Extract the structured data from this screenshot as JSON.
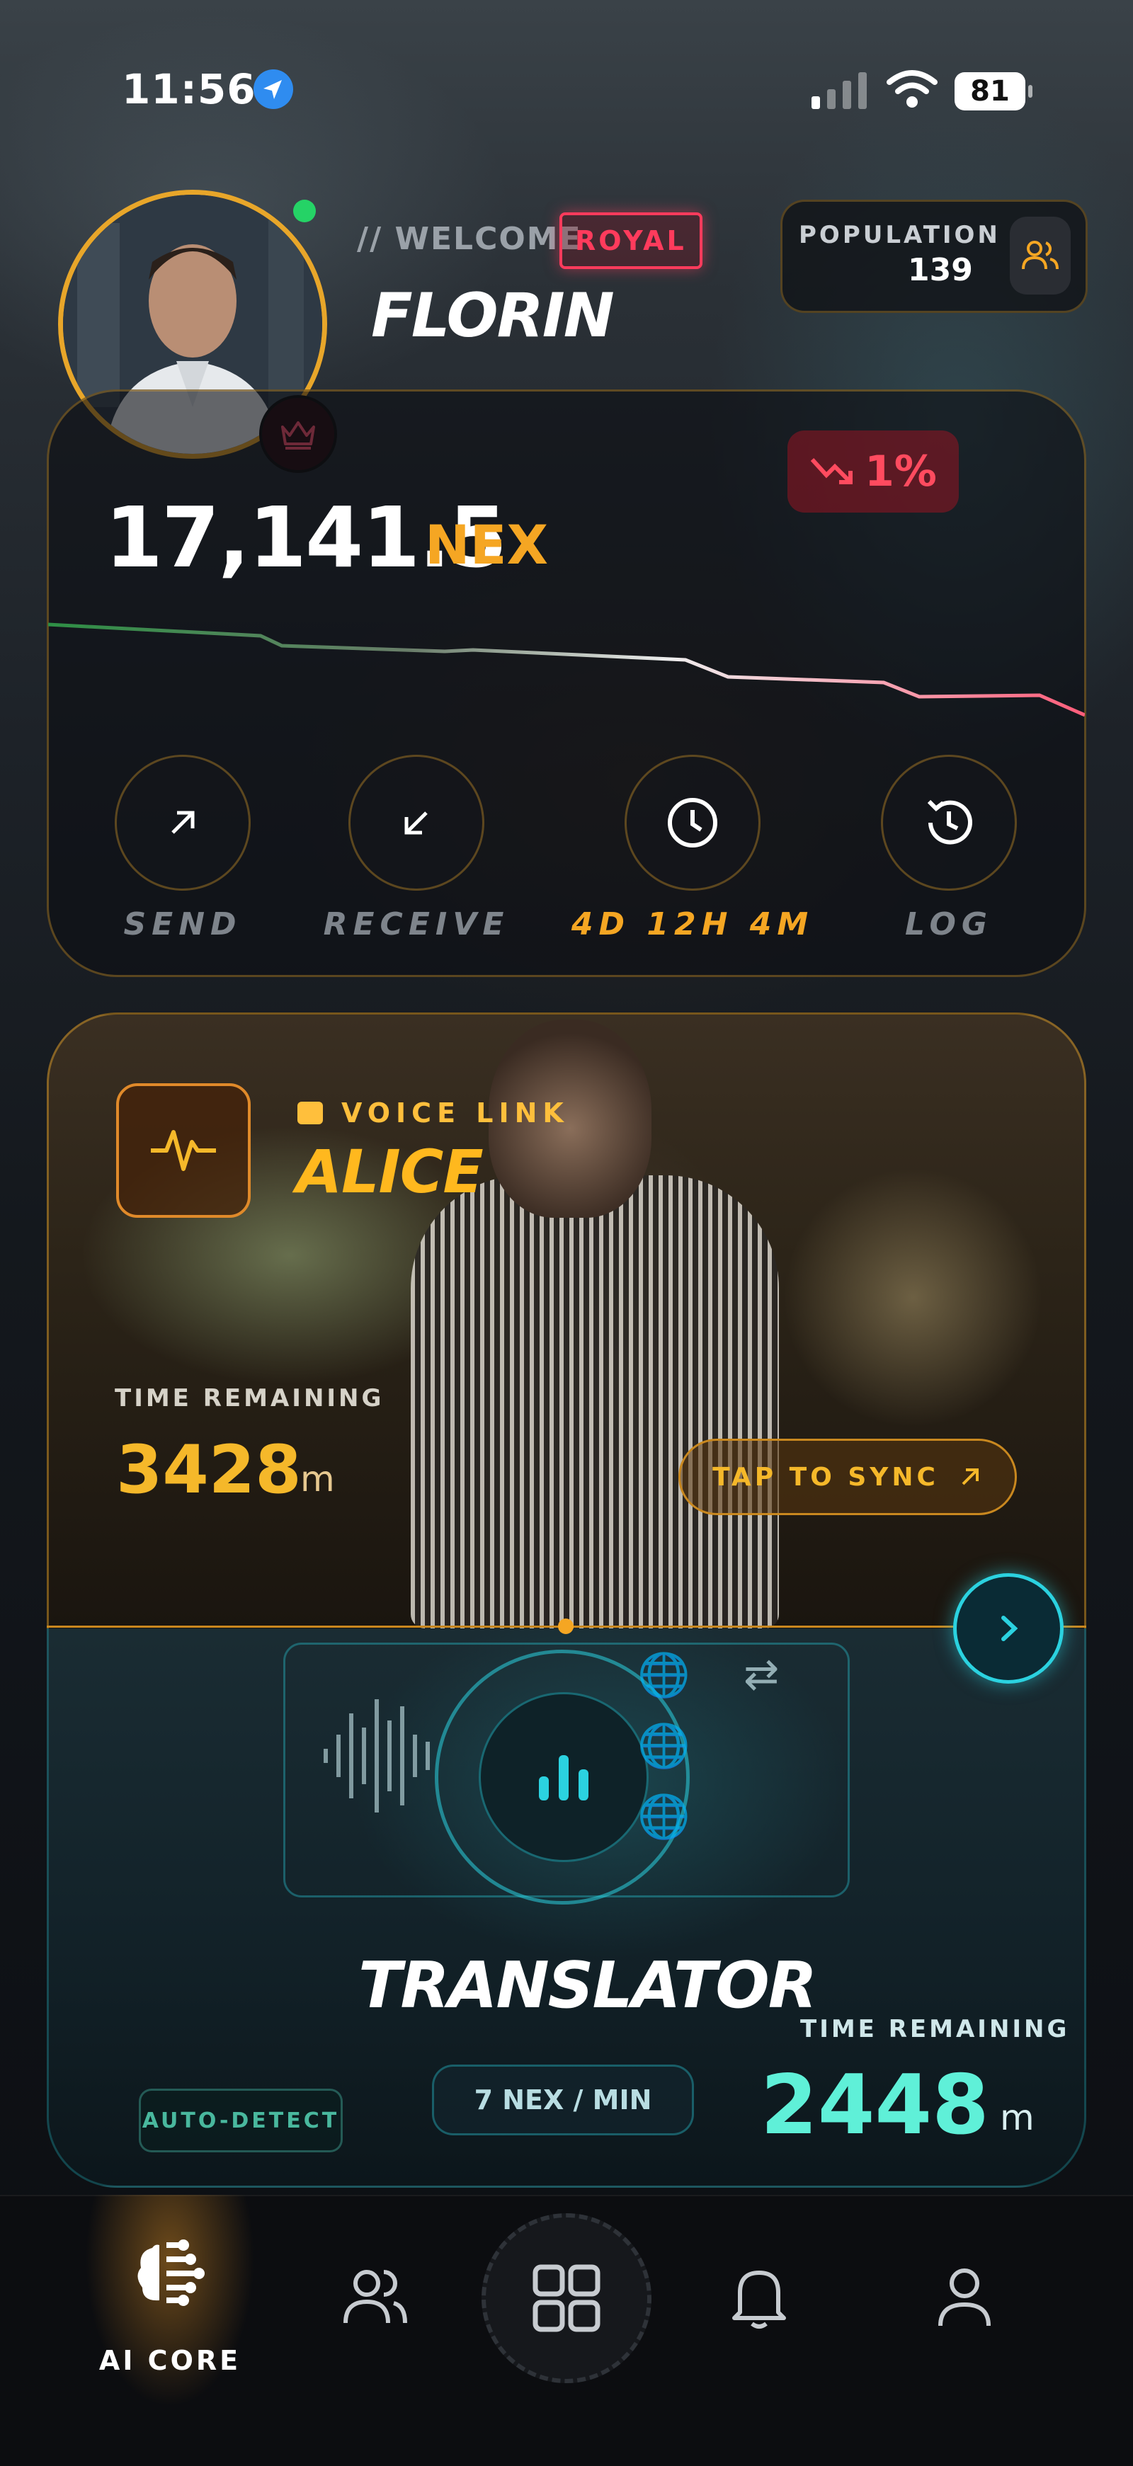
{
  "status_bar": {
    "time": "11:56",
    "battery": "81"
  },
  "profile": {
    "welcome_label": "// WELCOME",
    "rank_badge": "ROYAL",
    "username": "FLORIN"
  },
  "population": {
    "label": "POPULATION",
    "value": "139"
  },
  "wallet": {
    "balance": "17,141.5",
    "currency": "NEX",
    "change": "1%",
    "actions": [
      {
        "label": "SEND"
      },
      {
        "label": "RECEIVE"
      },
      {
        "label": "4D 12H 4M"
      },
      {
        "label": "LOG"
      }
    ]
  },
  "voice_link": {
    "tag": "VOICE LINK",
    "name": "ALICE",
    "time_label": "TIME REMAINING",
    "time_value": "3428",
    "time_unit": "m",
    "sync_label": "TAP TO SYNC"
  },
  "translator": {
    "name": "TRANSLATOR",
    "time_label": "TIME REMAINING",
    "time_value": "2448",
    "time_unit": "m",
    "auto_detect": "AUTO-DETECT",
    "rate": "7 NEX / MIN"
  },
  "bottom_nav": {
    "active_label": "AI CORE"
  },
  "colors": {
    "accent": "#f5a623",
    "teal": "#2bd2e0",
    "alert": "#ff3b5c"
  }
}
